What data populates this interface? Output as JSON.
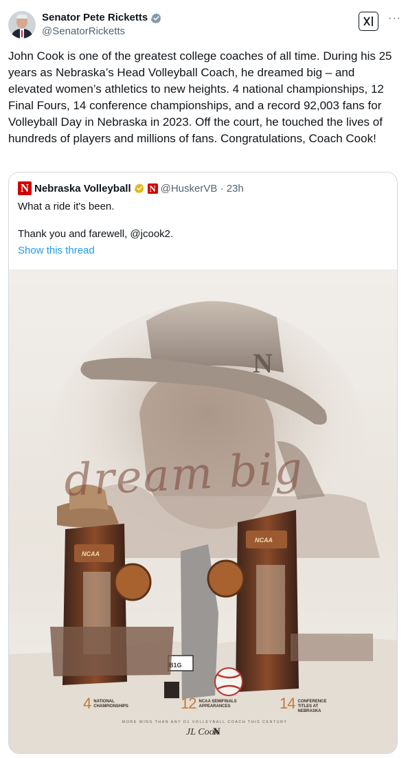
{
  "author": {
    "display_name": "Senator Pete Ricketts",
    "handle": "@SenatorRicketts"
  },
  "header_icons": [
    "verified-badge-icon",
    "xai-grok-icon",
    "more-icon"
  ],
  "tweet_text": "John Cook is one of the greatest college coaches of all time. During his 25 years as Nebraska’s Head Volleyball Coach, he dreamed big – and elevated women’s athletics to new heights. 4 national championships, 12 Final Fours, 14 conference championships, and a record 92,003 fans for Volleyball Day in Nebraska in 2023. Off the court, he touched the lives of hundreds of players and millions of fans. Congratulations, Coach Cook!",
  "quote": {
    "display_name": "Nebraska Volleyball",
    "handle_time": "@HuskerVB · 23h",
    "line1": "What a ride it's been.",
    "line2": "Thank you and farewell, @jcook2.",
    "show_thread": "Show this thread",
    "logo_letter": "N"
  },
  "poster": {
    "script_words": "dream big",
    "trophy_label_left": "NCAA",
    "trophy_label_right": "NCAA",
    "conference_label": "B1G",
    "stats": [
      {
        "number": "4",
        "label": "NATIONAL CHAMPIONSHIPS"
      },
      {
        "number": "12",
        "label": "NCAA SEMIFINALS APPEARANCES"
      },
      {
        "number": "14",
        "label": "CONFERENCE TITLES AT NEBRASKA"
      }
    ],
    "footer": "MORE WINS THAN ANY D1 VOLLEYBALL COACH THIS CENTURY",
    "signature": "JL Cook",
    "signature_logo": "N",
    "colors": {
      "accent": "#c47a3a",
      "trophy": "#6b3a22",
      "sky": "#f1eeea"
    }
  },
  "colors": {
    "link": "#1d9bf0",
    "muted": "#536471",
    "verified": "#829aab",
    "nebraska_red": "#d00000"
  }
}
